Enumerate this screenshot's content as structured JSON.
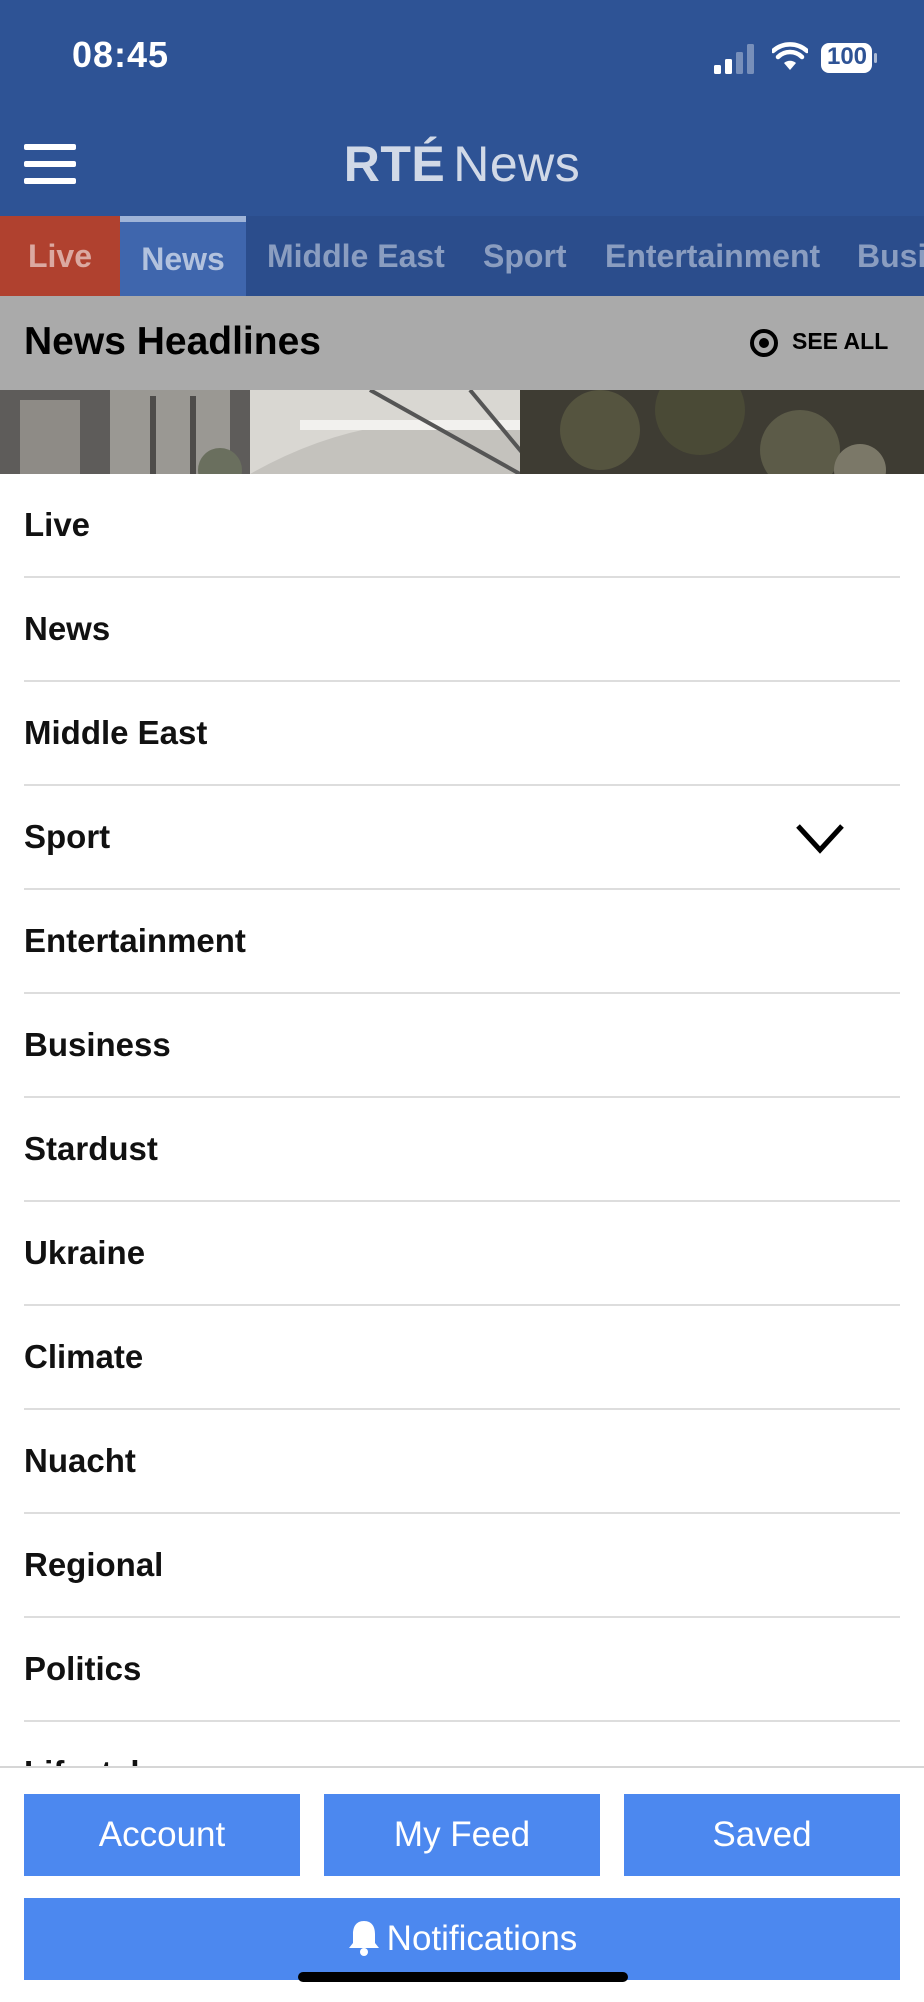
{
  "status_bar": {
    "time": "08:45",
    "battery": "100",
    "icons": [
      "signal-icon",
      "wifi-icon",
      "battery-icon"
    ]
  },
  "header": {
    "menu_icon": "hamburger-menu-icon",
    "logo_brand": "RTÉ",
    "logo_text": "News"
  },
  "tabs": [
    {
      "label": "Live"
    },
    {
      "label": "News",
      "selected": true
    },
    {
      "label": "Middle East"
    },
    {
      "label": "Sport"
    },
    {
      "label": "Entertainment"
    },
    {
      "label": "Busi"
    }
  ],
  "headlines": {
    "title": "News Headlines",
    "see_all": "SEE ALL",
    "icon": "eye-icon"
  },
  "menu": {
    "items": [
      {
        "label": "Live"
      },
      {
        "label": "News"
      },
      {
        "label": "Middle East"
      },
      {
        "label": "Sport",
        "expandable": true
      },
      {
        "label": "Entertainment"
      },
      {
        "label": "Business"
      },
      {
        "label": "Stardust"
      },
      {
        "label": "Ukraine"
      },
      {
        "label": "Climate"
      },
      {
        "label": "Nuacht"
      },
      {
        "label": "Regional"
      },
      {
        "label": "Politics"
      },
      {
        "label": "Lifestyle"
      }
    ],
    "expand_icon": "chevron-down-icon"
  },
  "bottom": {
    "account": "Account",
    "my_feed": "My Feed",
    "saved": "Saved",
    "notifications": "Notifications",
    "notifications_icon": "bell-icon"
  },
  "colors": {
    "header_bg": "#2e5395",
    "tabs_bg": "#2b4d8c",
    "live_tab": "#b0412f",
    "selected_tab": "#3f66ad",
    "button": "#4c88ef"
  }
}
